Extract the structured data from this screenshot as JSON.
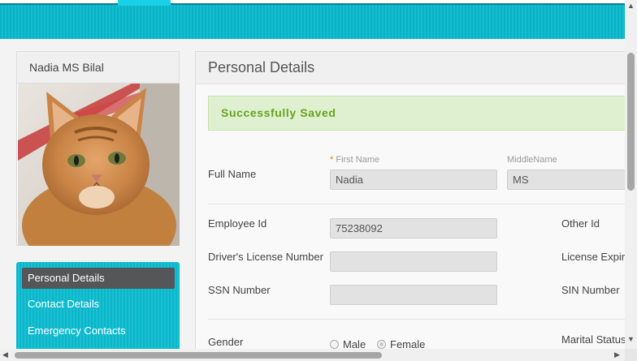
{
  "profile": {
    "name": "Nadia MS Bilal"
  },
  "menu": {
    "items": [
      {
        "label": "Personal Details"
      },
      {
        "label": "Contact Details"
      },
      {
        "label": "Emergency Contacts"
      }
    ]
  },
  "panel": {
    "title": "Personal Details",
    "success_message": "Successfully Saved",
    "full_name_label": "Full Name",
    "first_name": {
      "required_mark": "*",
      "label": "First Name",
      "value": "Nadia"
    },
    "middle_name": {
      "label": "MiddleName",
      "value": "MS"
    },
    "employee_id": {
      "label": "Employee Id",
      "value": "75238092"
    },
    "other_id": {
      "label": "Other Id"
    },
    "drivers_license": {
      "label": "Driver's License Number",
      "value": ""
    },
    "license_expiry": {
      "label": "License Expir"
    },
    "ssn": {
      "label": "SSN Number",
      "value": ""
    },
    "sin": {
      "label": "SIN Number"
    },
    "gender": {
      "label": "Gender",
      "options": [
        "Male",
        "Female"
      ],
      "selected": "Female"
    },
    "marital_status": {
      "label": "Marital Status"
    }
  },
  "icons": {
    "scroll_up": "scroll-up-arrow-icon",
    "scroll_down": "scroll-down-arrow-icon",
    "scroll_left": "scroll-left-arrow-icon",
    "scroll_right": "scroll-right-arrow-icon"
  },
  "colors": {
    "header": "#07b3c6",
    "menu_active": "#555657",
    "success_bg": "#dff0d0",
    "success_text": "#68a31e"
  }
}
